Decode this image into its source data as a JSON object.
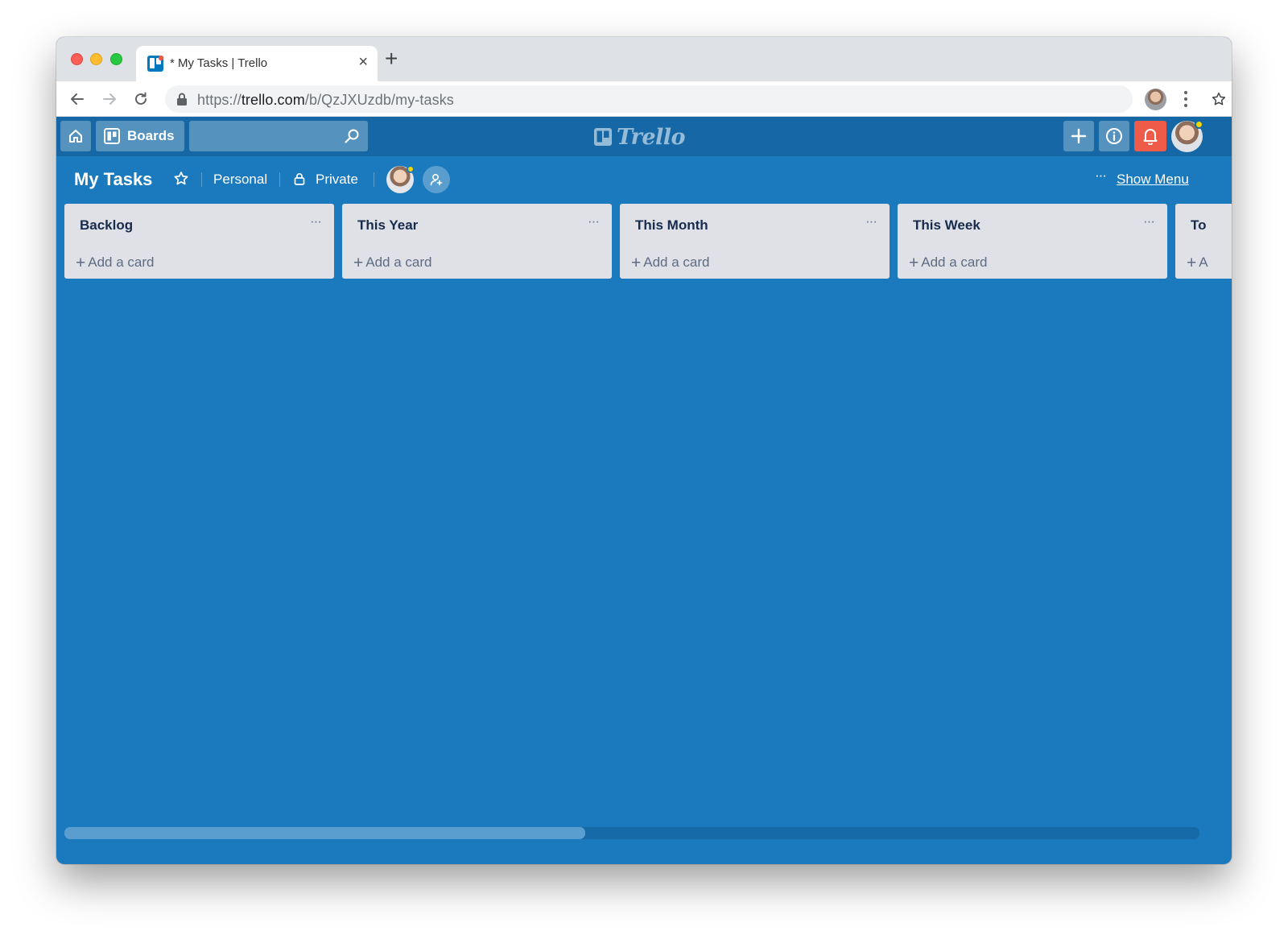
{
  "browser": {
    "tab_title": "* My Tasks | Trello",
    "new_tab_symbol": "+",
    "close_symbol": "×",
    "url_scheme": "https://",
    "url_host": "trello.com",
    "url_path": "/b/QzJXUzdb/my-tasks"
  },
  "app": {
    "boards_label": "Boards",
    "logo_text": "Trello",
    "search_placeholder": ""
  },
  "board": {
    "title": "My Tasks",
    "team": "Personal",
    "visibility": "Private",
    "menu_dots": "···",
    "show_menu": "Show Menu"
  },
  "lists": [
    {
      "title": "Backlog",
      "menu": "···",
      "add_card": "Add a card"
    },
    {
      "title": "This Year",
      "menu": "···",
      "add_card": "Add a card"
    },
    {
      "title": "This Month",
      "menu": "···",
      "add_card": "Add a card"
    },
    {
      "title": "This Week",
      "menu": "···",
      "add_card": "Add a card"
    },
    {
      "title": "To",
      "menu": "",
      "add_card": "A"
    }
  ],
  "add_card_plus": "+",
  "colors": {
    "board_background": "#1b79bd",
    "header_background": "#1568a5",
    "notification_red": "#ee5b48",
    "list_background": "#dfe1e6"
  },
  "scroll": {
    "position_fraction": 0.46
  }
}
